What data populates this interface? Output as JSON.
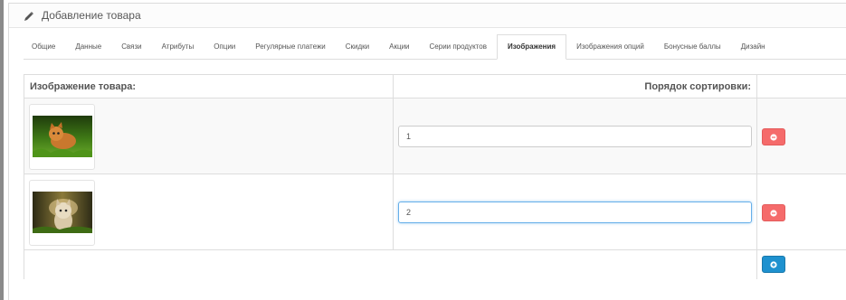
{
  "panel": {
    "title": "Добавление товара",
    "icon": "pencil-icon"
  },
  "tabs": [
    {
      "label": "Общие"
    },
    {
      "label": "Данные"
    },
    {
      "label": "Связи"
    },
    {
      "label": "Атрибуты"
    },
    {
      "label": "Опции"
    },
    {
      "label": "Регулярные платежи"
    },
    {
      "label": "Скидки"
    },
    {
      "label": "Акции"
    },
    {
      "label": "Серии продуктов"
    },
    {
      "label": "Изображения",
      "active": true
    },
    {
      "label": "Изображения опций"
    },
    {
      "label": "Бонусные баллы"
    },
    {
      "label": "Дизайн"
    }
  ],
  "table": {
    "headers": {
      "image": "Изображение товара:",
      "sort": "Порядок сортировки:"
    },
    "rows": [
      {
        "sort_order": "1",
        "remove_icon": "minus-circle-icon"
      },
      {
        "sort_order": "2",
        "remove_icon": "minus-circle-icon",
        "focused": true
      }
    ],
    "add_icon": "plus-circle-icon"
  },
  "colors": {
    "danger": "#f56b6b",
    "primary": "#1e91cf",
    "focus": "#66afe9"
  }
}
